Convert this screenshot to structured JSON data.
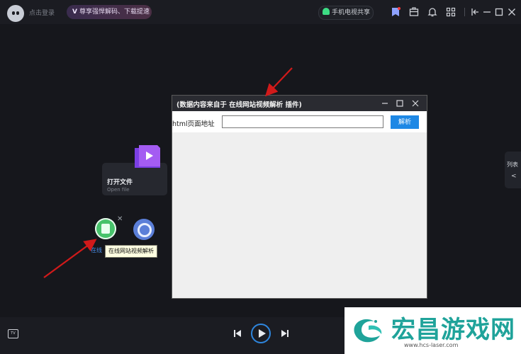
{
  "topbar": {
    "login_text": "点击登录",
    "vip_label": "尊享强悍解码、下载提速",
    "tv_share_label": "手机电视共享"
  },
  "card": {
    "title": "打开文件",
    "subtitle": "Open file"
  },
  "apps": {
    "label": "在线",
    "tooltip": "在线网站视频解析",
    "right_colon": ":"
  },
  "list_tab": {
    "label": "列表",
    "chevron": "<"
  },
  "dialog": {
    "title": "(数据内容来自于 在线网站视频解析 插件)",
    "url_label": "html页面地址",
    "url_value": "",
    "parse_button": "解析"
  },
  "bottombar": {
    "tv_label": "TV"
  },
  "watermark": {
    "text": "宏昌游戏网",
    "url": "www.hcs-laser.com"
  },
  "colors": {
    "background": "#16171c",
    "accent": "#1e88e5",
    "annotation_arrow": "#d11a1a",
    "watermark": "#1fa39a"
  }
}
